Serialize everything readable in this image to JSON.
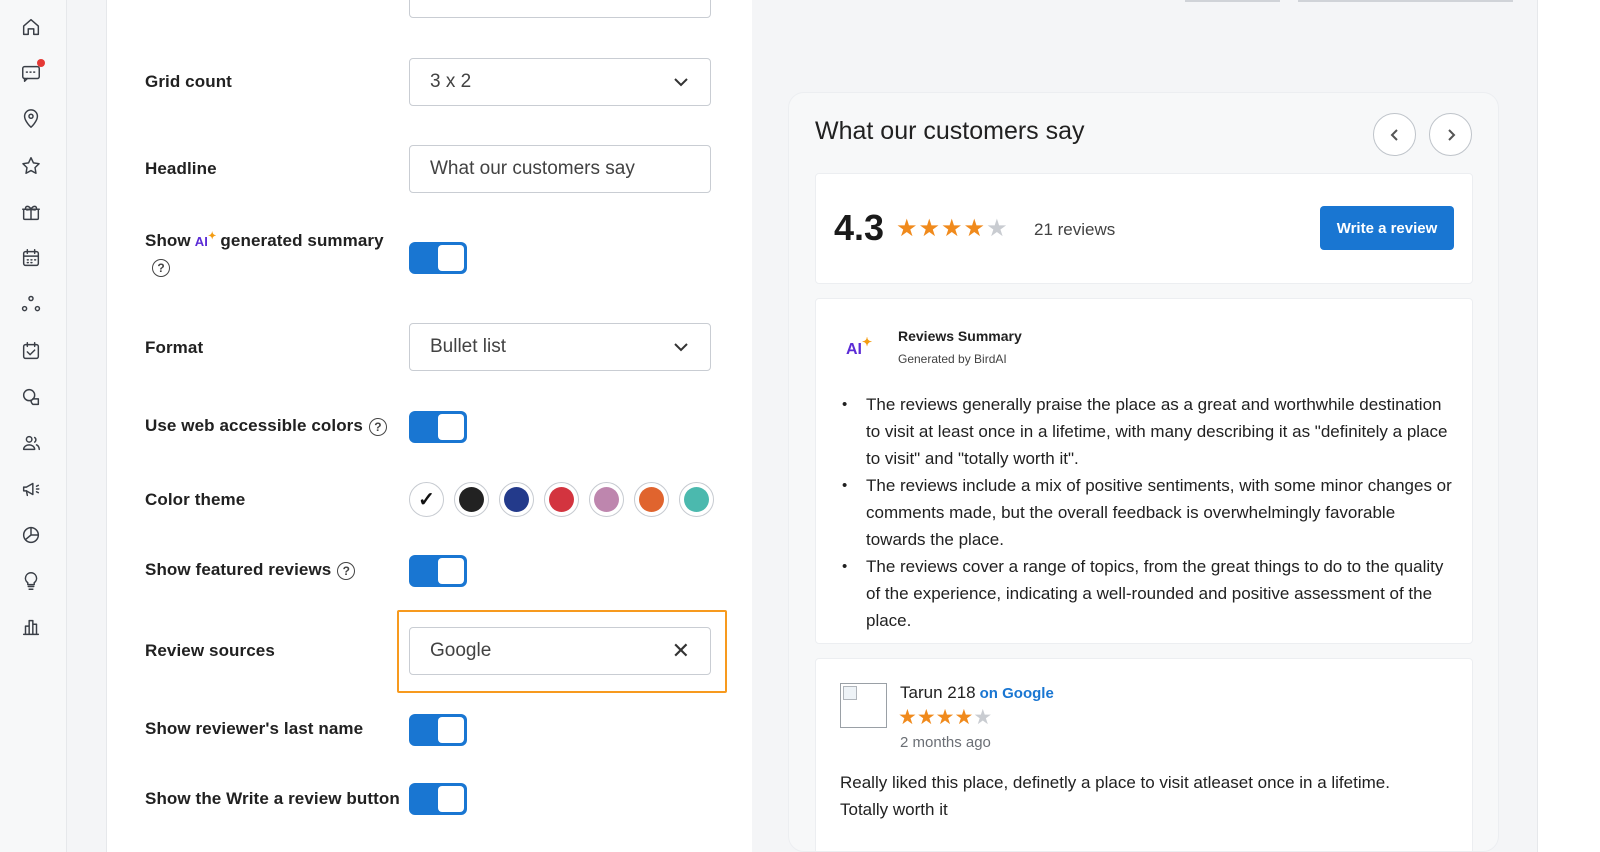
{
  "sidebar": {
    "items": [
      {
        "icon": "home-icon"
      },
      {
        "icon": "messages-icon",
        "has_notification": true
      },
      {
        "icon": "location-icon"
      },
      {
        "icon": "star-icon"
      },
      {
        "icon": "gift-icon"
      },
      {
        "icon": "calendar-icon"
      },
      {
        "icon": "network-icon"
      },
      {
        "icon": "checklist-icon"
      },
      {
        "icon": "chat-bubbles-icon"
      },
      {
        "icon": "contacts-icon"
      },
      {
        "icon": "megaphone-icon"
      },
      {
        "icon": "pie-chart-icon"
      },
      {
        "icon": "lightbulb-icon"
      },
      {
        "icon": "bar-chart-icon"
      }
    ]
  },
  "form": {
    "grid_count": {
      "label": "Grid count",
      "value": "3 x 2"
    },
    "headline": {
      "label": "Headline",
      "value": "What our customers say"
    },
    "summary": {
      "label_prefix": "Show",
      "ai_badge": "AI",
      "label_suffix": "generated summary",
      "enabled": true
    },
    "format": {
      "label": "Format",
      "value": "Bullet list"
    },
    "web_accessible": {
      "label": "Use web accessible colors",
      "enabled": true
    },
    "color_theme": {
      "label": "Color theme",
      "colors": [
        "#ffffff",
        "#222222",
        "#233a8b",
        "#d3343f",
        "#be86ae",
        "#e0642e",
        "#4bb9ae"
      ],
      "selected_index": 0
    },
    "featured": {
      "label": "Show featured reviews",
      "enabled": true
    },
    "review_sources": {
      "label": "Review sources",
      "value": "Google"
    },
    "last_name": {
      "label": "Show reviewer's last name",
      "enabled": true
    },
    "write_button": {
      "label": "Show the Write a review button",
      "enabled": true
    }
  },
  "preview": {
    "title": "What our customers say",
    "rating": "4.3",
    "stars_filled": 4,
    "reviews_count": "21 reviews",
    "write_review_label": "Write a review",
    "summary": {
      "ai_badge": "AI",
      "title": "Reviews Summary",
      "subtitle": "Generated by BirdAI",
      "bullets": [
        "The reviews generally praise the place as a great and worthwhile destination to visit at least once in a lifetime, with many describing it as \"definitely a place to visit\" and \"totally worth it\".",
        "The reviews include a mix of positive sentiments, with some minor changes or comments made, but the overall feedback is overwhelmingly favorable towards the place.",
        "The reviews cover a range of topics, from the great things to do to the quality of the experience, indicating a well-rounded and positive assessment of the place."
      ]
    },
    "review": {
      "name": "Tarun 218",
      "source_prefix": "on",
      "source": "Google",
      "stars_filled": 4,
      "date": "2 months ago",
      "text": "Really liked this place, definetly a place to visit atleaset once in a lifetime. Totally worth it"
    }
  },
  "colors": {
    "accent": "#1976d2",
    "highlight": "#f79a1e",
    "star": "#f08a1c",
    "ai": "#5b2bd6"
  }
}
